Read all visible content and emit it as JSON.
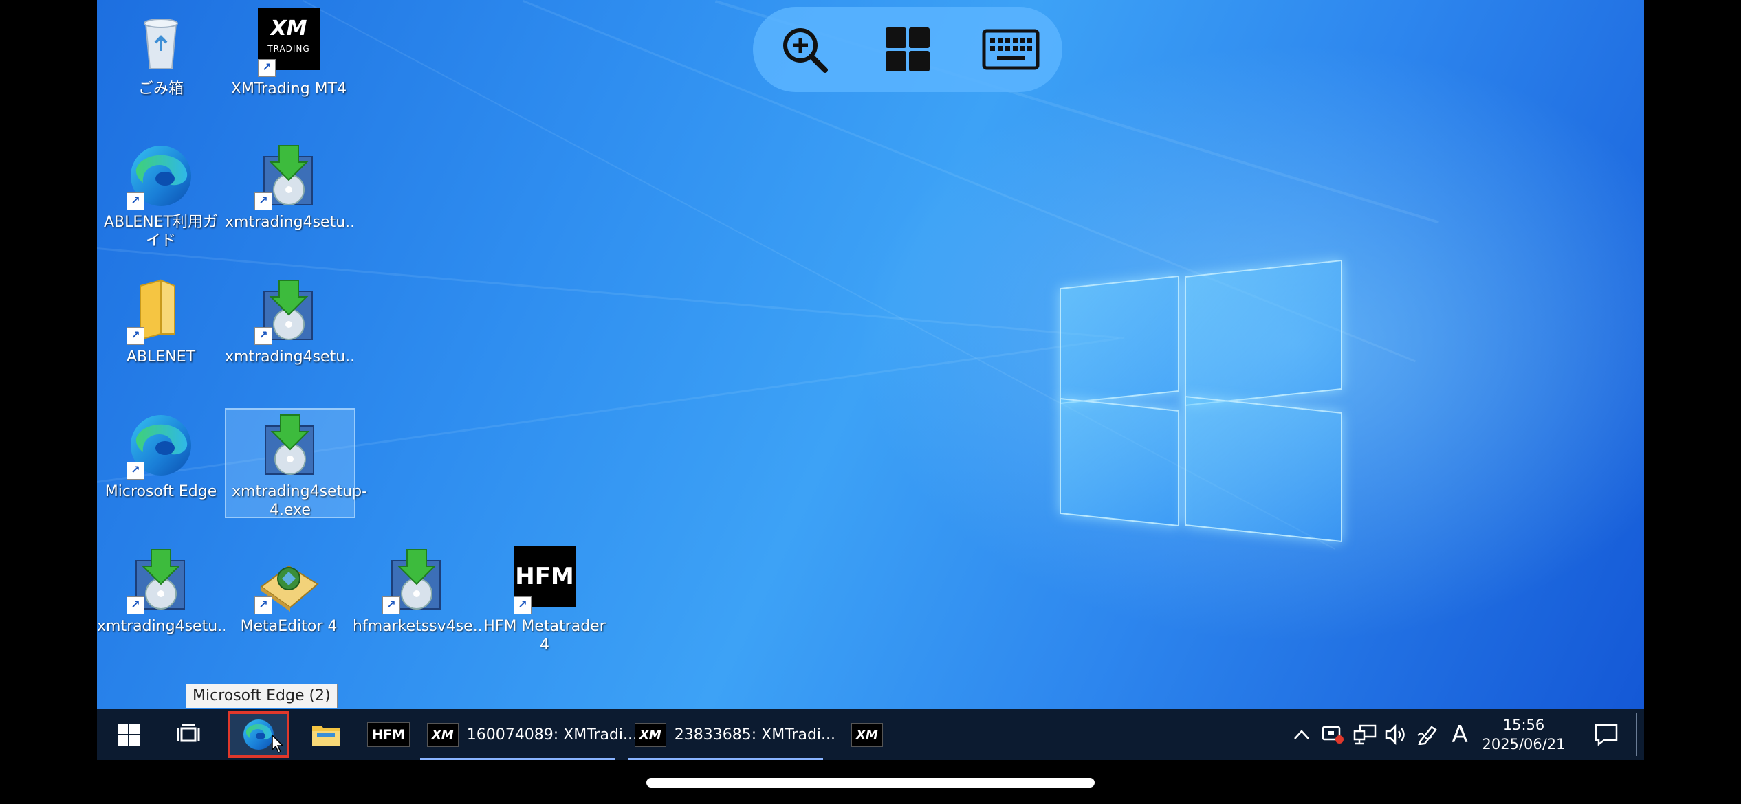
{
  "desktop": {
    "icons": [
      {
        "label": "ごみ箱",
        "icon": "recycle-bin-icon"
      },
      {
        "label": "XMTrading MT4",
        "icon": "xm-trading-icon",
        "badge_top": "XM",
        "badge_bottom": "TRADING"
      },
      {
        "label": "ABLENET利用ガイド",
        "icon": "edge-icon"
      },
      {
        "label": "xmtrading4setu...",
        "icon": "installer-icon"
      },
      {
        "label": "ABLENET",
        "icon": "folder-icon"
      },
      {
        "label": "xmtrading4setu...",
        "icon": "installer-icon"
      },
      {
        "label": "Microsoft Edge",
        "icon": "edge-icon"
      },
      {
        "label": "xmtrading4setup-4.exe",
        "icon": "installer-icon"
      },
      {
        "label": "xmtrading4setu...",
        "icon": "installer-icon"
      },
      {
        "label": "MetaEditor 4",
        "icon": "metaeditor-icon"
      },
      {
        "label": "hfmarketssv4se...",
        "icon": "installer-icon"
      },
      {
        "label": "HFM Metatrader 4",
        "icon": "hfm-icon",
        "badge": "HFM"
      }
    ]
  },
  "remote_toolbar": {
    "buttons": [
      {
        "name": "zoom-in-icon"
      },
      {
        "name": "windows-grid-icon"
      },
      {
        "name": "keyboard-icon"
      }
    ]
  },
  "tooltip": {
    "text": "Microsoft Edge (2)"
  },
  "taskbar": {
    "apps": [
      {
        "label": "160074089: XMTradi...",
        "icon": "XM"
      },
      {
        "label": "23833685: XMTradi...",
        "icon": "XM"
      }
    ],
    "hfm_label": "HFM",
    "xm_label": "XM",
    "tray": {
      "ime": "A",
      "time": "15:56",
      "date": "2025/06/21"
    }
  },
  "colors": {
    "taskbar_bg": "#0c1b30",
    "highlight_border": "#e0382b",
    "desktop_blue": "#2f8ef0"
  }
}
